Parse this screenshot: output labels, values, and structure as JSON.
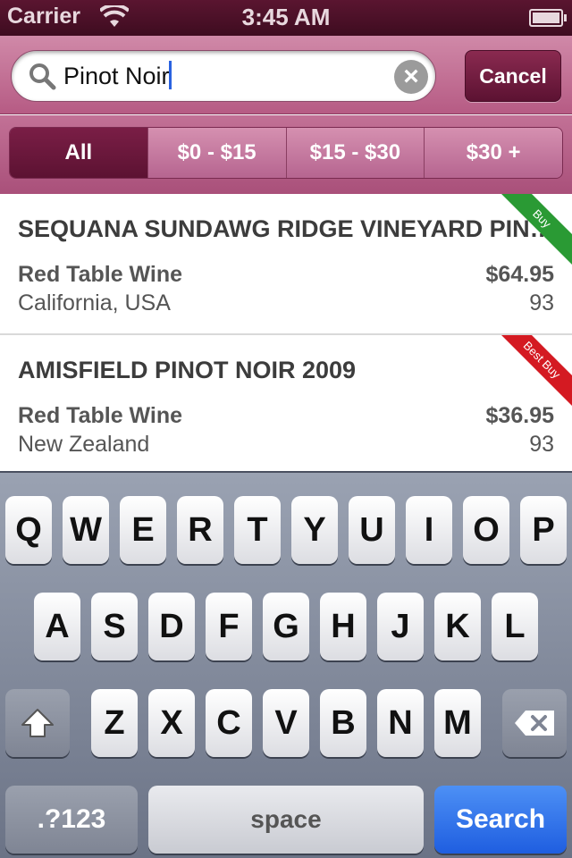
{
  "status_bar": {
    "carrier": "Carrier",
    "time": "3:45 AM"
  },
  "search": {
    "value": "Pinot Noir",
    "cancel_label": "Cancel"
  },
  "filters": [
    {
      "label": "All",
      "active": true
    },
    {
      "label": "$0 - $15",
      "active": false
    },
    {
      "label": "$15 - $30",
      "active": false
    },
    {
      "label": "$30 +",
      "active": false
    }
  ],
  "results": [
    {
      "name": "SEQUANA SUNDAWG RIDGE VINEYARD PINOT NOIR",
      "type": "Red Table Wine",
      "origin": "California, USA",
      "price": "$64.95",
      "score": "93",
      "ribbon": "Buy",
      "ribbon_color": "#2a9a34"
    },
    {
      "name": "AMISFIELD PINOT NOIR 2009",
      "type": "Red Table Wine",
      "origin": "New Zealand",
      "price": "$36.95",
      "score": "93",
      "ribbon": "Best Buy",
      "ribbon_color": "#d41a22"
    }
  ],
  "keyboard": {
    "row1": [
      "Q",
      "W",
      "E",
      "R",
      "T",
      "Y",
      "U",
      "I",
      "O",
      "P"
    ],
    "row2": [
      "A",
      "S",
      "D",
      "F",
      "G",
      "H",
      "J",
      "K",
      "L"
    ],
    "row3": [
      "Z",
      "X",
      "C",
      "V",
      "B",
      "N",
      "M"
    ],
    "numbers_label": ".?123",
    "space_label": "space",
    "search_label": "Search"
  }
}
